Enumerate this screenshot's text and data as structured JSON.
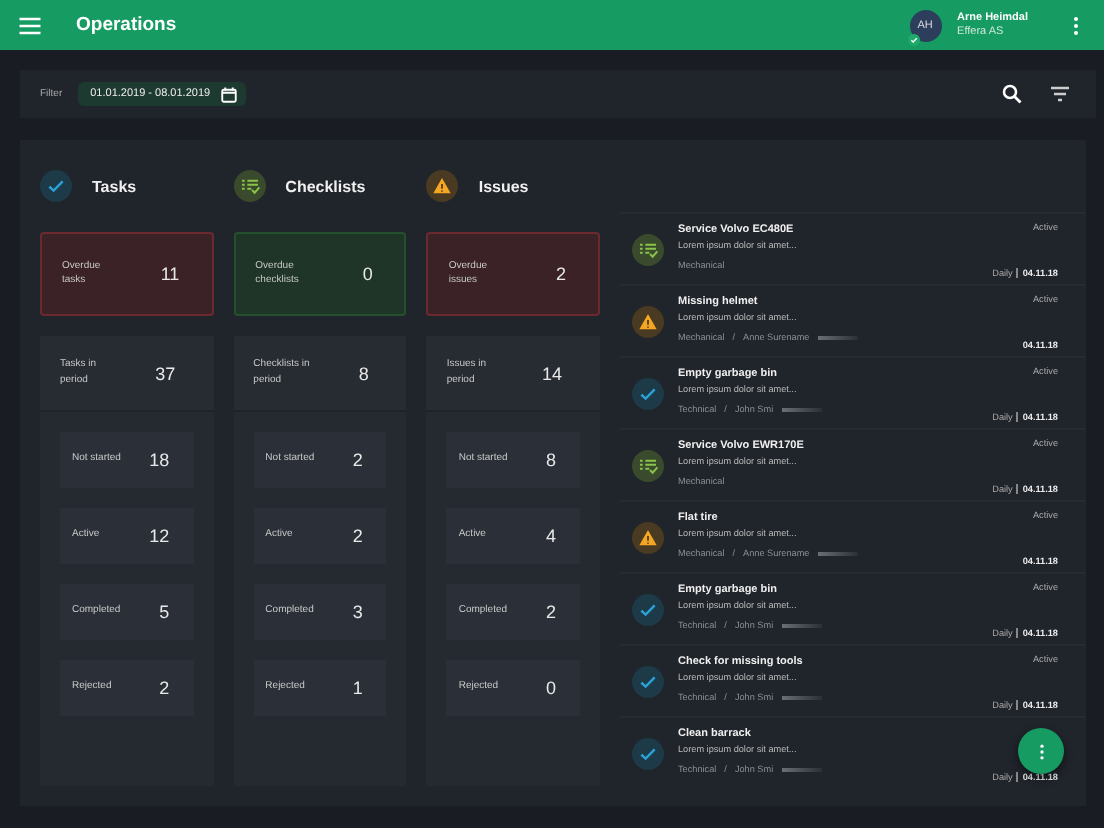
{
  "app_bar": {
    "title": "Operations",
    "user": {
      "initials": "AH",
      "verified": true,
      "name": "Arne Heimdal",
      "company": "Effera AS"
    }
  },
  "filter": {
    "label": "Filter",
    "date_range": "01.01.2019 - 08.01.2019"
  },
  "categories": [
    {
      "kind": "task",
      "title": "Tasks",
      "overdue": {
        "label": "Overdue tasks",
        "value": "11",
        "alert": true
      },
      "total": {
        "label": "Tasks in period",
        "value": "37"
      },
      "stats": [
        {
          "label": "Not started",
          "value": "18"
        },
        {
          "label": "Active",
          "value": "12"
        },
        {
          "label": "Completed",
          "value": "5"
        },
        {
          "label": "Rejected",
          "value": "2"
        }
      ]
    },
    {
      "kind": "checklist",
      "title": "Checklists",
      "overdue": {
        "label": "Overdue checklists",
        "value": "0",
        "alert": false
      },
      "total": {
        "label": "Checklists in period",
        "value": "8"
      },
      "stats": [
        {
          "label": "Not started",
          "value": "2"
        },
        {
          "label": "Active",
          "value": "2"
        },
        {
          "label": "Completed",
          "value": "3"
        },
        {
          "label": "Rejected",
          "value": "1"
        }
      ]
    },
    {
      "kind": "issue",
      "title": "Issues",
      "overdue": {
        "label": "Overdue issues",
        "value": "2",
        "alert": true
      },
      "total": {
        "label": "Issues in period",
        "value": "14"
      },
      "stats": [
        {
          "label": "Not started",
          "value": "8"
        },
        {
          "label": "Active",
          "value": "4"
        },
        {
          "label": "Completed",
          "value": "2"
        },
        {
          "label": "Rejected",
          "value": "0"
        }
      ]
    }
  ],
  "items": [
    {
      "kind": "checklist",
      "title": "Service Volvo EC480E",
      "description": "Lorem ipsum dolor sit amet...",
      "category": "Mechanical",
      "status": "Active",
      "frequency": "Daily",
      "date": "04.11.18"
    },
    {
      "kind": "issue",
      "title": "Missing helmet",
      "description": "Lorem ipsum dolor sit amet...",
      "category": "Mechanical",
      "separator": "/",
      "person": "Anne Surename",
      "status": "Active",
      "date": "04.11.18"
    },
    {
      "kind": "task",
      "title": "Empty garbage bin",
      "description": "Lorem ipsum dolor sit amet...",
      "category": "Technical",
      "separator": "/",
      "person": "John Smi",
      "status": "Active",
      "frequency": "Daily",
      "date": "04.11.18"
    },
    {
      "kind": "checklist",
      "title": "Service Volvo EWR170E",
      "description": "Lorem ipsum dolor sit amet...",
      "category": "Mechanical",
      "status": "Active",
      "frequency": "Daily",
      "date": "04.11.18"
    },
    {
      "kind": "issue",
      "title": "Flat tire",
      "description": "Lorem ipsum dolor sit amet...",
      "category": "Mechanical",
      "separator": "/",
      "person": "Anne Surename",
      "status": "Active",
      "date": "04.11.18"
    },
    {
      "kind": "task",
      "title": "Empty garbage bin",
      "description": "Lorem ipsum dolor sit amet...",
      "category": "Technical",
      "separator": "/",
      "person": "John Smi",
      "status": "Active",
      "frequency": "Daily",
      "date": "04.11.18"
    },
    {
      "kind": "task",
      "title": "Check for missing tools",
      "description": "Lorem ipsum dolor sit amet...",
      "category": "Technical",
      "separator": "/",
      "person": "John Smi",
      "status": "Active",
      "frequency": "Daily",
      "date": "04.11.18"
    },
    {
      "kind": "task",
      "title": "Clean barrack",
      "description": "Lorem ipsum dolor sit amet...",
      "category": "Technical",
      "separator": "/",
      "person": "John Smi",
      "frequency": "Daily",
      "date": "04.11.18"
    }
  ]
}
